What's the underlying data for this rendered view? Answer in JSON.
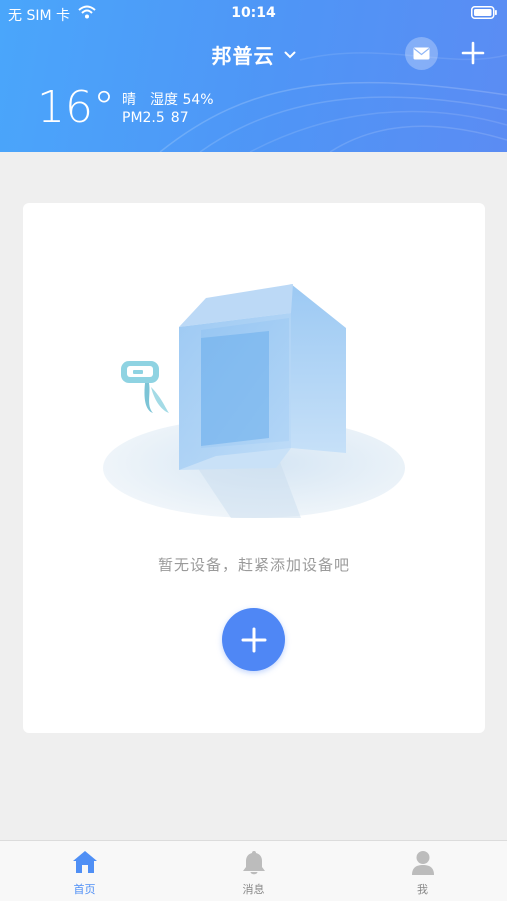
{
  "status_bar": {
    "carrier": "无 SIM 卡",
    "time": "10:14"
  },
  "header": {
    "title": "邦普云",
    "mail_icon": "mail-icon",
    "add_icon": "plus-icon"
  },
  "weather": {
    "temperature": "16°",
    "condition": "晴",
    "humidity": "湿度 54%",
    "pm_label": "PM2.5",
    "pm_value": "87"
  },
  "empty_state": {
    "message": "暂无设备，赶紧添加设备吧"
  },
  "tabbar": {
    "items": [
      {
        "label": "首页",
        "icon": "home-icon",
        "active": true
      },
      {
        "label": "消息",
        "icon": "bell-icon",
        "active": false
      },
      {
        "label": "我",
        "icon": "user-icon",
        "active": false
      }
    ]
  },
  "colors": {
    "header_gradient_start": "#4aa6fb",
    "header_gradient_end": "#5b8cf3",
    "accent": "#4f87f5",
    "background": "#efefef",
    "muted_text": "#9a9a9a"
  }
}
